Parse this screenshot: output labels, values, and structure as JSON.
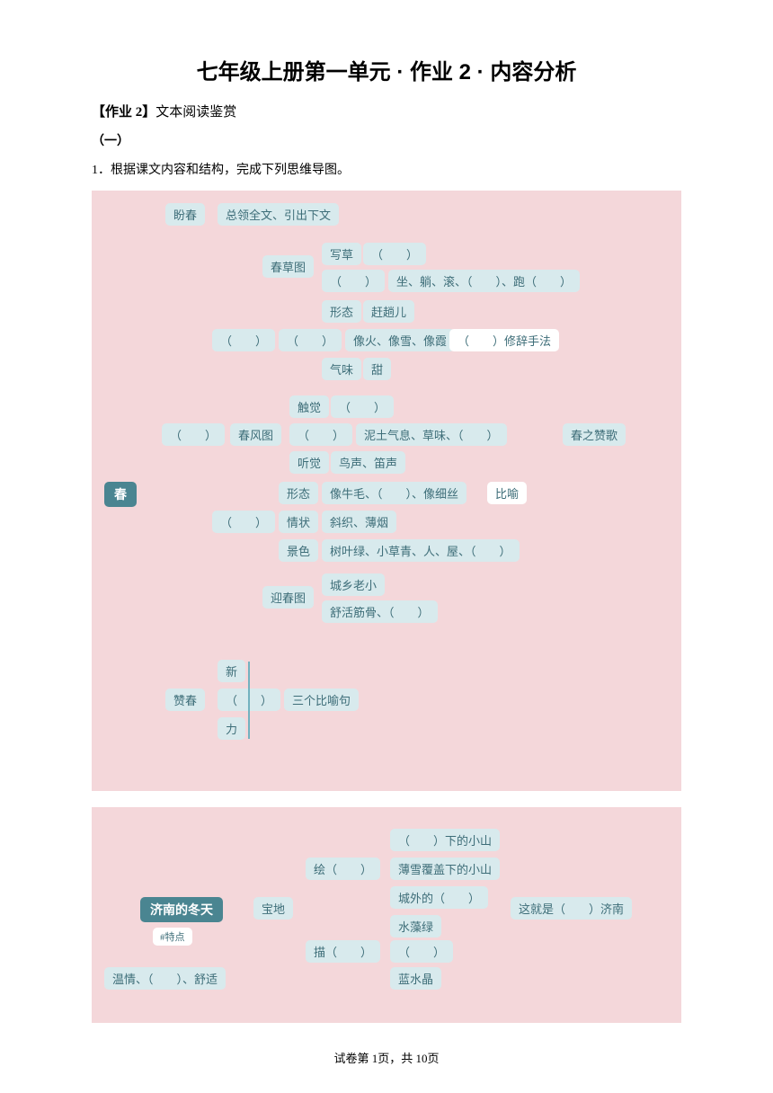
{
  "title": "七年级上册第一单元 · 作业 2 · 内容分析",
  "sub_label": "【作业 2】",
  "sub_trail": "文本阅读鉴赏",
  "section": "（一）",
  "q1": "1．根据课文内容和结构，完成下列思维导图。",
  "m1": {
    "root": "春",
    "pan": "盼春",
    "pan_txt": "总领全文、引出下文",
    "blank": "（　　）",
    "cao": "春草图",
    "cao1": "写草",
    "cao2": "坐、躺、滚、（　　）、跑（　　）",
    "blankx": "（　　）",
    "xt": "形态",
    "xt_v": "赶趟儿",
    "xt2": "像火、像雪、像霞",
    "xt2b": "（　　）修辞手法",
    "qi": "气味",
    "qi_v": "甜",
    "feng": "春风图",
    "cj": "触觉",
    "cj2": "泥土气息、草味、（　　）",
    "tj": "听觉",
    "tj_v": "鸟声、笛声",
    "right": "春之赞歌",
    "xt3": "形态",
    "xt3_v": "像牛毛、（　　）、像细丝",
    "bh": "比喻",
    "qz": "情状",
    "qz_v": "斜织、薄烟",
    "js": "景色",
    "js_v": "树叶绿、小草青、人、屋、（　　）",
    "ying": "迎春图",
    "ying1": "城乡老小",
    "ying2": "舒活筋骨、（　　）",
    "zan": "赞春",
    "zan1": "新",
    "zan3": "力",
    "zan_r": "三个比喻句"
  },
  "m2": {
    "root": "济南的冬天",
    "tag": "#特点",
    "bottom": "温情、（　　）、舒适",
    "bao": "宝地",
    "hui": "绘（　　）",
    "miao": "描（　　）",
    "h1": "（　　）下的小山",
    "h2": "薄雪覆盖下的小山",
    "h3": "城外的（　　）",
    "m1": "水藻绿",
    "m2": "（　　）",
    "m3": "蓝水晶",
    "right": "这就是（　　）济南"
  },
  "footer": "试卷第 1页，共 10页"
}
